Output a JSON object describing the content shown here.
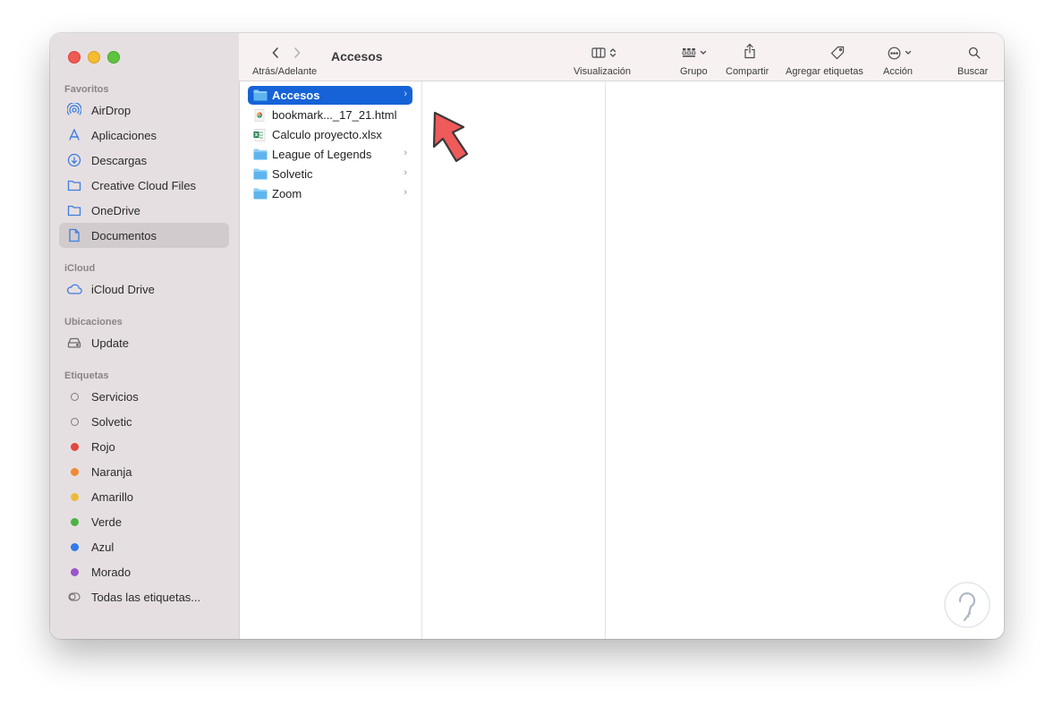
{
  "window": {
    "title": "Accesos"
  },
  "toolbar": {
    "nav_label": "Atrás/Adelante",
    "view_label": "Visualización",
    "group_label": "Grupo",
    "share_label": "Compartir",
    "tags_label": "Agregar etiquetas",
    "action_label": "Acción",
    "search_label": "Buscar"
  },
  "sidebar": {
    "favorites_title": "Favoritos",
    "favorites": [
      {
        "label": "AirDrop",
        "icon": "airdrop-icon"
      },
      {
        "label": "Aplicaciones",
        "icon": "applications-icon"
      },
      {
        "label": "Descargas",
        "icon": "downloads-icon"
      },
      {
        "label": "Creative Cloud Files",
        "icon": "folder-icon"
      },
      {
        "label": "OneDrive",
        "icon": "folder-icon"
      },
      {
        "label": "Documentos",
        "icon": "document-icon",
        "selected": true
      }
    ],
    "icloud_title": "iCloud",
    "icloud": [
      {
        "label": "iCloud Drive",
        "icon": "cloud-icon"
      }
    ],
    "locations_title": "Ubicaciones",
    "locations": [
      {
        "label": "Update",
        "icon": "drive-icon"
      }
    ],
    "tags_title": "Etiquetas",
    "tags": [
      {
        "label": "Servicios",
        "color": "none"
      },
      {
        "label": "Solvetic",
        "color": "none"
      },
      {
        "label": "Rojo",
        "color": "#e5463f"
      },
      {
        "label": "Naranja",
        "color": "#ef8a35"
      },
      {
        "label": "Amarillo",
        "color": "#ecbb36"
      },
      {
        "label": "Verde",
        "color": "#4cb343"
      },
      {
        "label": "Azul",
        "color": "#2f7bea"
      },
      {
        "label": "Morado",
        "color": "#9a55c8"
      },
      {
        "label": "Todas las etiquetas...",
        "color": "all"
      }
    ]
  },
  "column1": {
    "items": [
      {
        "name": "Accesos",
        "type": "folder",
        "selected": true,
        "has_children": true
      },
      {
        "name": "bookmark..._17_21.html",
        "type": "html",
        "has_children": false
      },
      {
        "name": "Calculo proyecto.xlsx",
        "type": "xlsx",
        "has_children": false
      },
      {
        "name": "League of Legends",
        "type": "folder",
        "has_children": true
      },
      {
        "name": "Solvetic",
        "type": "folder",
        "has_children": true
      },
      {
        "name": "Zoom",
        "type": "folder",
        "has_children": true
      }
    ]
  },
  "colors": {
    "accent": "#1663d7",
    "sidebar_bg": "#e6dfe1",
    "sidebar_icon": "#3d7ee0",
    "annotation_arrow": "#ef5a5a"
  }
}
